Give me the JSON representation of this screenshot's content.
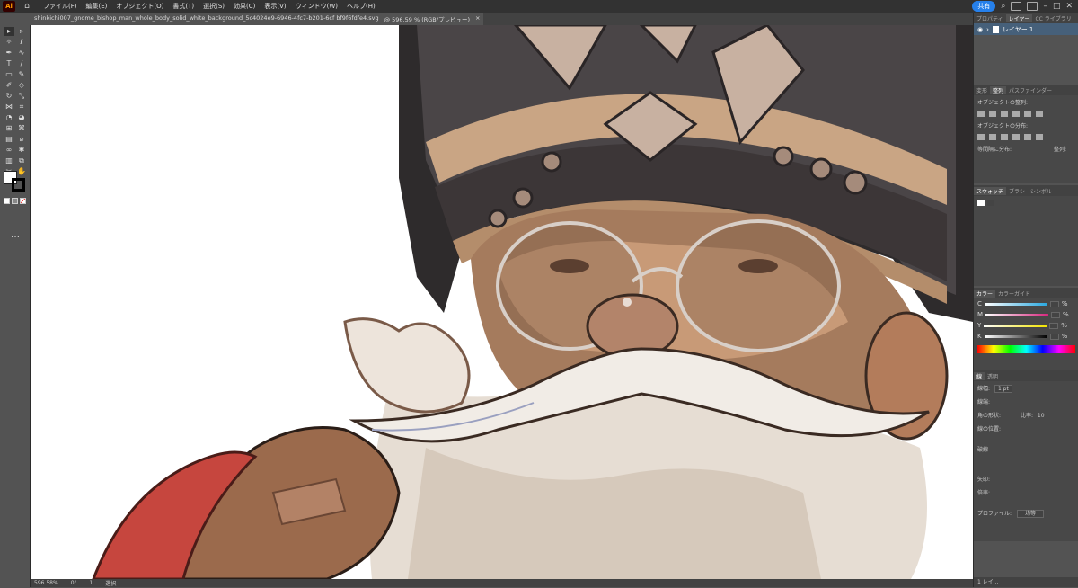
{
  "app": {
    "logo_text": "Ai"
  },
  "menu": [
    "ファイル(F)",
    "編集(E)",
    "オブジェクト(O)",
    "書式(T)",
    "選択(S)",
    "効果(C)",
    "表示(V)",
    "ウィンドウ(W)",
    "ヘルプ(H)"
  ],
  "share_label": "共有",
  "document": {
    "tab_title": "shinkichi007_gnome_bishop_man_whole_body_solid_white_background_5c4024e9-6946-4fc7-b201-6cf bf9f6fdfe4.svg",
    "tab_zoom": "@ 596.59 % (RGB/プレビュー)",
    "close": "×"
  },
  "status": {
    "zoom": "596.58%",
    "rotation": "0°",
    "artboard": "1",
    "mode": "選択"
  },
  "panel": {
    "top_tabs": [
      "プロパティ",
      "レイヤー",
      "CC ライブラリ"
    ],
    "layer_name": "レイヤー 1",
    "align_tabs": [
      "変形",
      "整列",
      "パスファインダー"
    ],
    "align_object_label": "オブジェクトの整列:",
    "distribute_label": "オブジェクトの分布:",
    "spacing_label": "等間隔に分布:",
    "align_to_label": "整列:",
    "swatch_tabs": [
      "スウォッチ",
      "ブラシ",
      "シンボル"
    ],
    "color_tabs": [
      "カラー",
      "カラーガイド"
    ],
    "cmyk": [
      {
        "label": "C",
        "unit": "%",
        "color": "#29a8e0"
      },
      {
        "label": "M",
        "unit": "%",
        "color": "#d6267d"
      },
      {
        "label": "Y",
        "unit": "%",
        "color": "#f2e500"
      },
      {
        "label": "K",
        "unit": "%",
        "color": "#666666"
      }
    ],
    "stroke_tabs": [
      "線",
      "透明"
    ],
    "stroke_weight_label": "線幅:",
    "stroke_weight_value": "1 pt",
    "cap_label": "線端:",
    "corner_label": "角の形状:",
    "limit_label": "比率:",
    "limit_value": "10",
    "align_stroke_label": "線の位置:",
    "dashed_label": "破線",
    "arrow_label": "矢印:",
    "scale_label": "倍率:",
    "profile_label": "プロファイル:",
    "profile_value": "均等",
    "footer_layer": "1 レイ..."
  }
}
